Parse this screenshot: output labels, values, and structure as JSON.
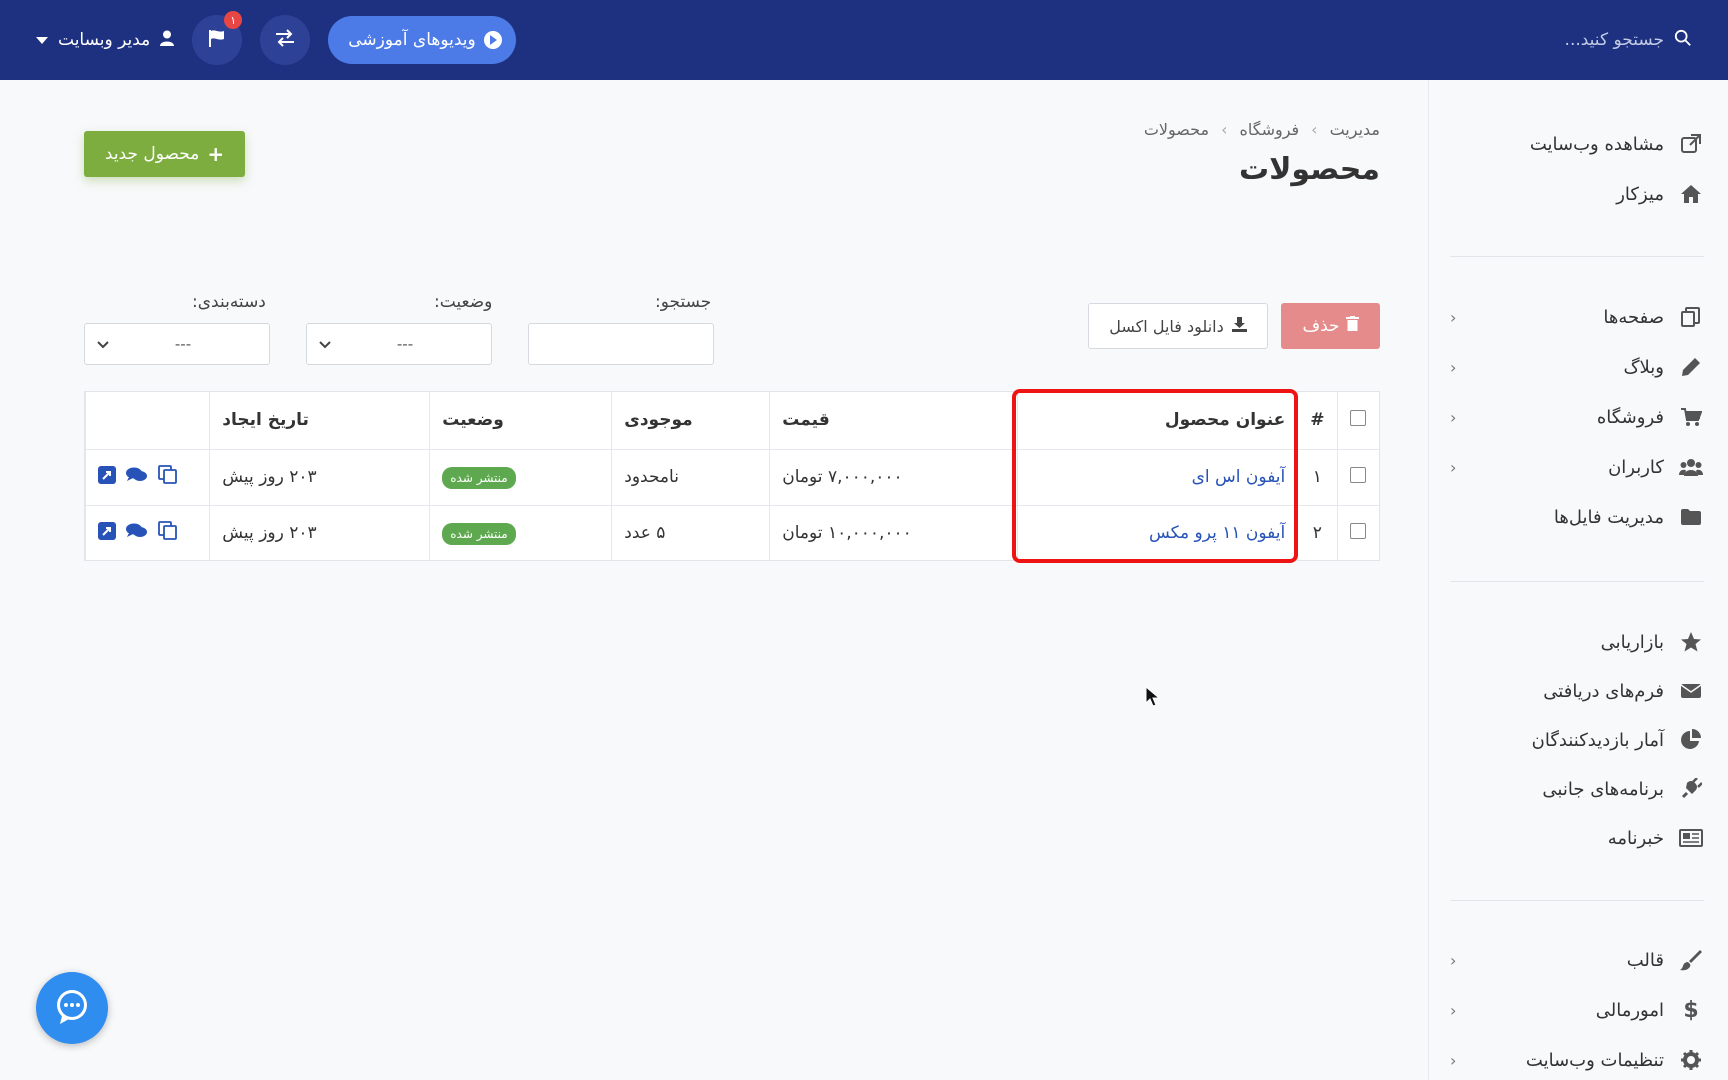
{
  "topbar": {
    "search_placeholder": "جستجو کنید...",
    "video_button": "ویدیوهای آموزشی",
    "notification_count": "۱",
    "user_label": "مدیر وبسایت"
  },
  "sidebar": {
    "group1": [
      {
        "label": "مشاهده وب‌سایت",
        "icon": "external-link-icon"
      },
      {
        "label": "میزکار",
        "icon": "home-icon"
      }
    ],
    "group2": [
      {
        "label": "صفحه‌ها",
        "icon": "pages-icon"
      },
      {
        "label": "وبلاگ",
        "icon": "pencil-icon"
      },
      {
        "label": "فروشگاه",
        "icon": "cart-icon"
      },
      {
        "label": "کاربران",
        "icon": "users-icon"
      },
      {
        "label": "مدیریت فایل‌ها",
        "icon": "folder-icon"
      }
    ],
    "group3": [
      {
        "label": "بازاریابی",
        "icon": "star-icon"
      },
      {
        "label": "فرم‌های دریافتی",
        "icon": "envelope-icon"
      },
      {
        "label": "آمار بازدیدکنندگان",
        "icon": "pie-chart-icon"
      },
      {
        "label": "برنامه‌های جانبی",
        "icon": "plug-icon"
      },
      {
        "label": "خبرنامه",
        "icon": "newspaper-icon"
      }
    ],
    "group4": [
      {
        "label": "قالب",
        "icon": "brush-icon"
      },
      {
        "label": "امورمالی",
        "icon": "dollar-icon"
      },
      {
        "label": "تنظیمات وب‌سایت",
        "icon": "gear-icon"
      }
    ]
  },
  "breadcrumb": [
    "مدیریت",
    "فروشگاه",
    "محصولات"
  ],
  "page_title": "محصولات",
  "new_button": "محصول جدید",
  "delete_button": "حذف",
  "excel_button": "دانلود فایل اکسل",
  "filters": {
    "search_label": "جستجو:",
    "status_label": "وضعیت:",
    "status_value": "---",
    "category_label": "دسته‌بندی:",
    "category_value": "---"
  },
  "table": {
    "headers": [
      "#",
      "عنوان محصول",
      "قیمت",
      "موجودی",
      "وضعیت",
      "تاریخ ایجاد"
    ],
    "rows": [
      {
        "num": "۱",
        "title": "آیفون اس ای",
        "price": "۷,۰۰۰,۰۰۰ تومان",
        "stock": "نامحدود",
        "status": "منتشر شده",
        "date": "۲۰۳ روز پیش"
      },
      {
        "num": "۲",
        "title": "آیفون ۱۱ پرو مکس",
        "price": "۱۰,۰۰۰,۰۰۰ تومان",
        "stock": "۵ عدد",
        "status": "منتشر شده",
        "date": "۲۰۳ روز پیش"
      }
    ]
  },
  "colors": {
    "topbar": "#1d3180",
    "accent_blue": "#4c7be8",
    "new_button": "#7cad3e",
    "delete_button": "#e68b8b",
    "badge": "#5ea94f",
    "highlight": "#ee1414",
    "link": "#2753b8"
  }
}
